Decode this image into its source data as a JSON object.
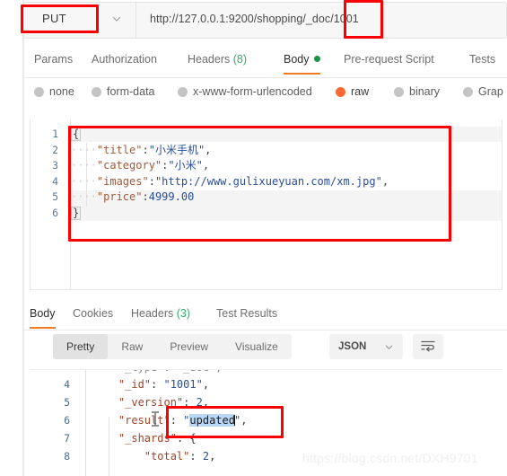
{
  "request": {
    "method": "PUT",
    "url": "http://127.0.0.1:9200/shopping/_doc/1001",
    "tabs": [
      {
        "label": "Params",
        "active": false,
        "badge": ""
      },
      {
        "label": "Authorization",
        "active": false,
        "badge": ""
      },
      {
        "label": "Headers",
        "active": false,
        "badge": "(8)"
      },
      {
        "label": "Body",
        "active": true,
        "badge": ""
      },
      {
        "label": "Pre-request Script",
        "active": false,
        "badge": ""
      },
      {
        "label": "Tests",
        "active": false,
        "badge": ""
      }
    ],
    "body_types": [
      {
        "label": "none",
        "selected": false
      },
      {
        "label": "form-data",
        "selected": false
      },
      {
        "label": "x-www-form-urlencoded",
        "selected": false
      },
      {
        "label": "raw",
        "selected": true
      },
      {
        "label": "binary",
        "selected": false
      },
      {
        "label": "Grap",
        "selected": false
      }
    ],
    "editor": {
      "line_numbers": [
        "1",
        "2",
        "3",
        "4",
        "5",
        "6"
      ],
      "lines": [
        {
          "indent": "",
          "key": "",
          "text_open": "{"
        },
        {
          "indent": "····",
          "key": "\"title\"",
          "sep": ":",
          "value": "\"小米手机\"",
          "comma": ","
        },
        {
          "indent": "····",
          "key": "\"category\"",
          "sep": ":",
          "value": "\"小米\"",
          "comma": ","
        },
        {
          "indent": "····",
          "key": "\"images\"",
          "sep": ":",
          "value": "\"http://www.gulixueyuan.com/xm.jpg\"",
          "comma": ","
        },
        {
          "indent": "····",
          "key": "\"price\"",
          "sep": ":",
          "value": "4999.00",
          "comma": ""
        },
        {
          "indent": "",
          "key": "",
          "text_close": "}"
        }
      ]
    }
  },
  "response": {
    "tabs": [
      {
        "label": "Body",
        "active": true,
        "badge": ""
      },
      {
        "label": "Cookies",
        "active": false,
        "badge": ""
      },
      {
        "label": "Headers",
        "active": false,
        "badge": "(3)"
      },
      {
        "label": "Test Results",
        "active": false,
        "badge": ""
      }
    ],
    "view_modes": [
      {
        "label": "Pretty",
        "active": true
      },
      {
        "label": "Raw",
        "active": false
      },
      {
        "label": "Preview",
        "active": false
      },
      {
        "label": "Visualize",
        "active": false
      }
    ],
    "format": "JSON",
    "body": {
      "line_numbers": [
        "4",
        "5",
        "6",
        "7",
        "8"
      ],
      "lines": [
        {
          "indent": "    ",
          "key": "\"_id\"",
          "sep": ": ",
          "value": "\"1001\"",
          "comma": ",",
          "value_type": "string"
        },
        {
          "indent": "    ",
          "key": "\"_version\"",
          "sep": ": ",
          "value": "2",
          "comma": ",",
          "value_type": "number"
        },
        {
          "indent": "    ",
          "key": "\"result\"",
          "sep": ": ",
          "value_prefix": "\"",
          "value": "updated",
          "value_suffix": "\"",
          "comma": ",",
          "value_type": "string",
          "selected": true
        },
        {
          "indent": "    ",
          "key": "\"_shards\"",
          "sep": ": ",
          "value": "{",
          "comma": "",
          "value_type": "brace"
        },
        {
          "indent": "        ",
          "key": "\"total\"",
          "sep": ": ",
          "value": "2",
          "comma": ",",
          "value_type": "number"
        }
      ]
    }
  },
  "watermark": "https://blog.csdn.net/DXH9701",
  "colors": {
    "accent": "#ef7d25",
    "annotation": "#fb0000",
    "json_key": "#a05a3a",
    "json_value": "#2a4e9a",
    "badge_green": "#3aa86a",
    "selection": "#b9d7f7"
  }
}
